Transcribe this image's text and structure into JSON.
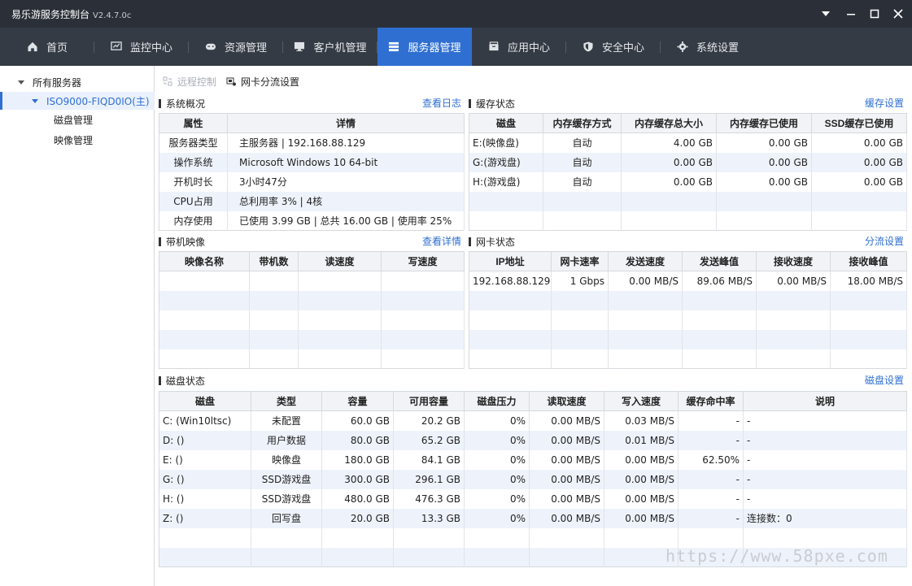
{
  "app": {
    "title": "易乐游服务控制台",
    "version": "V2.4.7.0c"
  },
  "window_controls": [
    {
      "name": "menu"
    },
    {
      "name": "minimize"
    },
    {
      "name": "maximize"
    },
    {
      "name": "close"
    }
  ],
  "nav": [
    {
      "label": "首页",
      "icon": "home-icon"
    },
    {
      "label": "监控中心",
      "icon": "monitor-chart-icon"
    },
    {
      "label": "资源管理",
      "icon": "gamepad-icon"
    },
    {
      "label": "客户机管理",
      "icon": "desktop-icon"
    },
    {
      "label": "服务器管理",
      "icon": "server-icon",
      "active": true
    },
    {
      "label": "应用中心",
      "icon": "box-icon"
    },
    {
      "label": "安全中心",
      "icon": "shield-icon"
    },
    {
      "label": "系统设置",
      "icon": "gear-icon"
    }
  ],
  "sidebar": {
    "root": "所有服务器",
    "server": "ISO9000-FIQD0IO(主)",
    "children": [
      "磁盘管理",
      "映像管理"
    ]
  },
  "toolbar": {
    "remote_control": "远程控制",
    "nic_split": "网卡分流设置"
  },
  "system": {
    "title": "系统概况",
    "link": "查看日志",
    "headers": [
      "属性",
      "详情"
    ],
    "rows": [
      [
        "服务器类型",
        "主服务器 | 192.168.88.129"
      ],
      [
        "操作系统",
        "Microsoft Windows 10 64-bit"
      ],
      [
        "开机时长",
        "3小时47分"
      ],
      [
        "CPU占用",
        "总利用率 3% | 4核"
      ],
      [
        "内存使用",
        "已使用 3.99 GB | 总共 16.00 GB | 使用率 25%"
      ]
    ]
  },
  "cache": {
    "title": "缓存状态",
    "link": "缓存设置",
    "headers": [
      "磁盘",
      "内存缓存方式",
      "内存缓存总大小",
      "内存缓存已使用",
      "SSD缓存已使用"
    ],
    "rows": [
      [
        "E:(映像盘)",
        "自动",
        "4.00 GB",
        "0.00 GB",
        "0.00 GB"
      ],
      [
        "G:(游戏盘)",
        "自动",
        "0.00 GB",
        "0.00 GB",
        "0.00 GB"
      ],
      [
        "H:(游戏盘)",
        "自动",
        "0.00 GB",
        "0.00 GB",
        "0.00 GB"
      ],
      [
        "",
        "",
        "",
        "",
        ""
      ],
      [
        "",
        "",
        "",
        "",
        ""
      ]
    ]
  },
  "image": {
    "title": "带机映像",
    "link": "查看详情",
    "headers": [
      "映像名称",
      "带机数",
      "读速度",
      "写速度"
    ],
    "rows": [
      [
        "",
        "",
        "",
        ""
      ],
      [
        "",
        "",
        "",
        ""
      ],
      [
        "",
        "",
        "",
        ""
      ],
      [
        "",
        "",
        "",
        ""
      ],
      [
        "",
        "",
        "",
        ""
      ]
    ]
  },
  "nic": {
    "title": "网卡状态",
    "link": "分流设置",
    "headers": [
      "IP地址",
      "网卡速率",
      "发送速度",
      "发送峰值",
      "接收速度",
      "接收峰值"
    ],
    "rows": [
      [
        "192.168.88.129",
        "1 Gbps",
        "0.00 MB/S",
        "89.06 MB/S",
        "0.00 MB/S",
        "18.00 MB/S"
      ],
      [
        "",
        "",
        "",
        "",
        "",
        ""
      ],
      [
        "",
        "",
        "",
        "",
        "",
        ""
      ],
      [
        "",
        "",
        "",
        "",
        "",
        ""
      ],
      [
        "",
        "",
        "",
        "",
        "",
        ""
      ]
    ]
  },
  "disk": {
    "title": "磁盘状态",
    "link": "磁盘设置",
    "headers": [
      "磁盘",
      "类型",
      "容量",
      "可用容量",
      "磁盘压力",
      "读取速度",
      "写入速度",
      "缓存命中率",
      "说明"
    ],
    "rows": [
      [
        "C: (Win10ltsc)",
        "未配置",
        "60.0 GB",
        "20.2 GB",
        "0%",
        "0.00 MB/S",
        "0.03 MB/S",
        "-",
        "-"
      ],
      [
        "D: ()",
        "用户数据",
        "80.0 GB",
        "65.2 GB",
        "0%",
        "0.00 MB/S",
        "0.01 MB/S",
        "-",
        "-"
      ],
      [
        "E: ()",
        "映像盘",
        "180.0 GB",
        "84.1 GB",
        "0%",
        "0.00 MB/S",
        "0.00 MB/S",
        "62.50%",
        "-"
      ],
      [
        "G: ()",
        "SSD游戏盘",
        "300.0 GB",
        "296.1 GB",
        "0%",
        "0.00 MB/S",
        "0.00 MB/S",
        "-",
        "-"
      ],
      [
        "H: ()",
        "SSD游戏盘",
        "480.0 GB",
        "476.3 GB",
        "0%",
        "0.00 MB/S",
        "0.00 MB/S",
        "-",
        "-"
      ],
      [
        "Z: ()",
        "回写盘",
        "20.0 GB",
        "13.3 GB",
        "0%",
        "0.00 MB/S",
        "0.00 MB/S",
        "-",
        "连接数：0"
      ],
      [
        "",
        "",
        "",
        "",
        "",
        "",
        "",
        "",
        ""
      ],
      [
        "",
        "",
        "",
        "",
        "",
        "",
        "",
        "",
        ""
      ]
    ]
  },
  "watermark": "https://www.58pxe.com"
}
